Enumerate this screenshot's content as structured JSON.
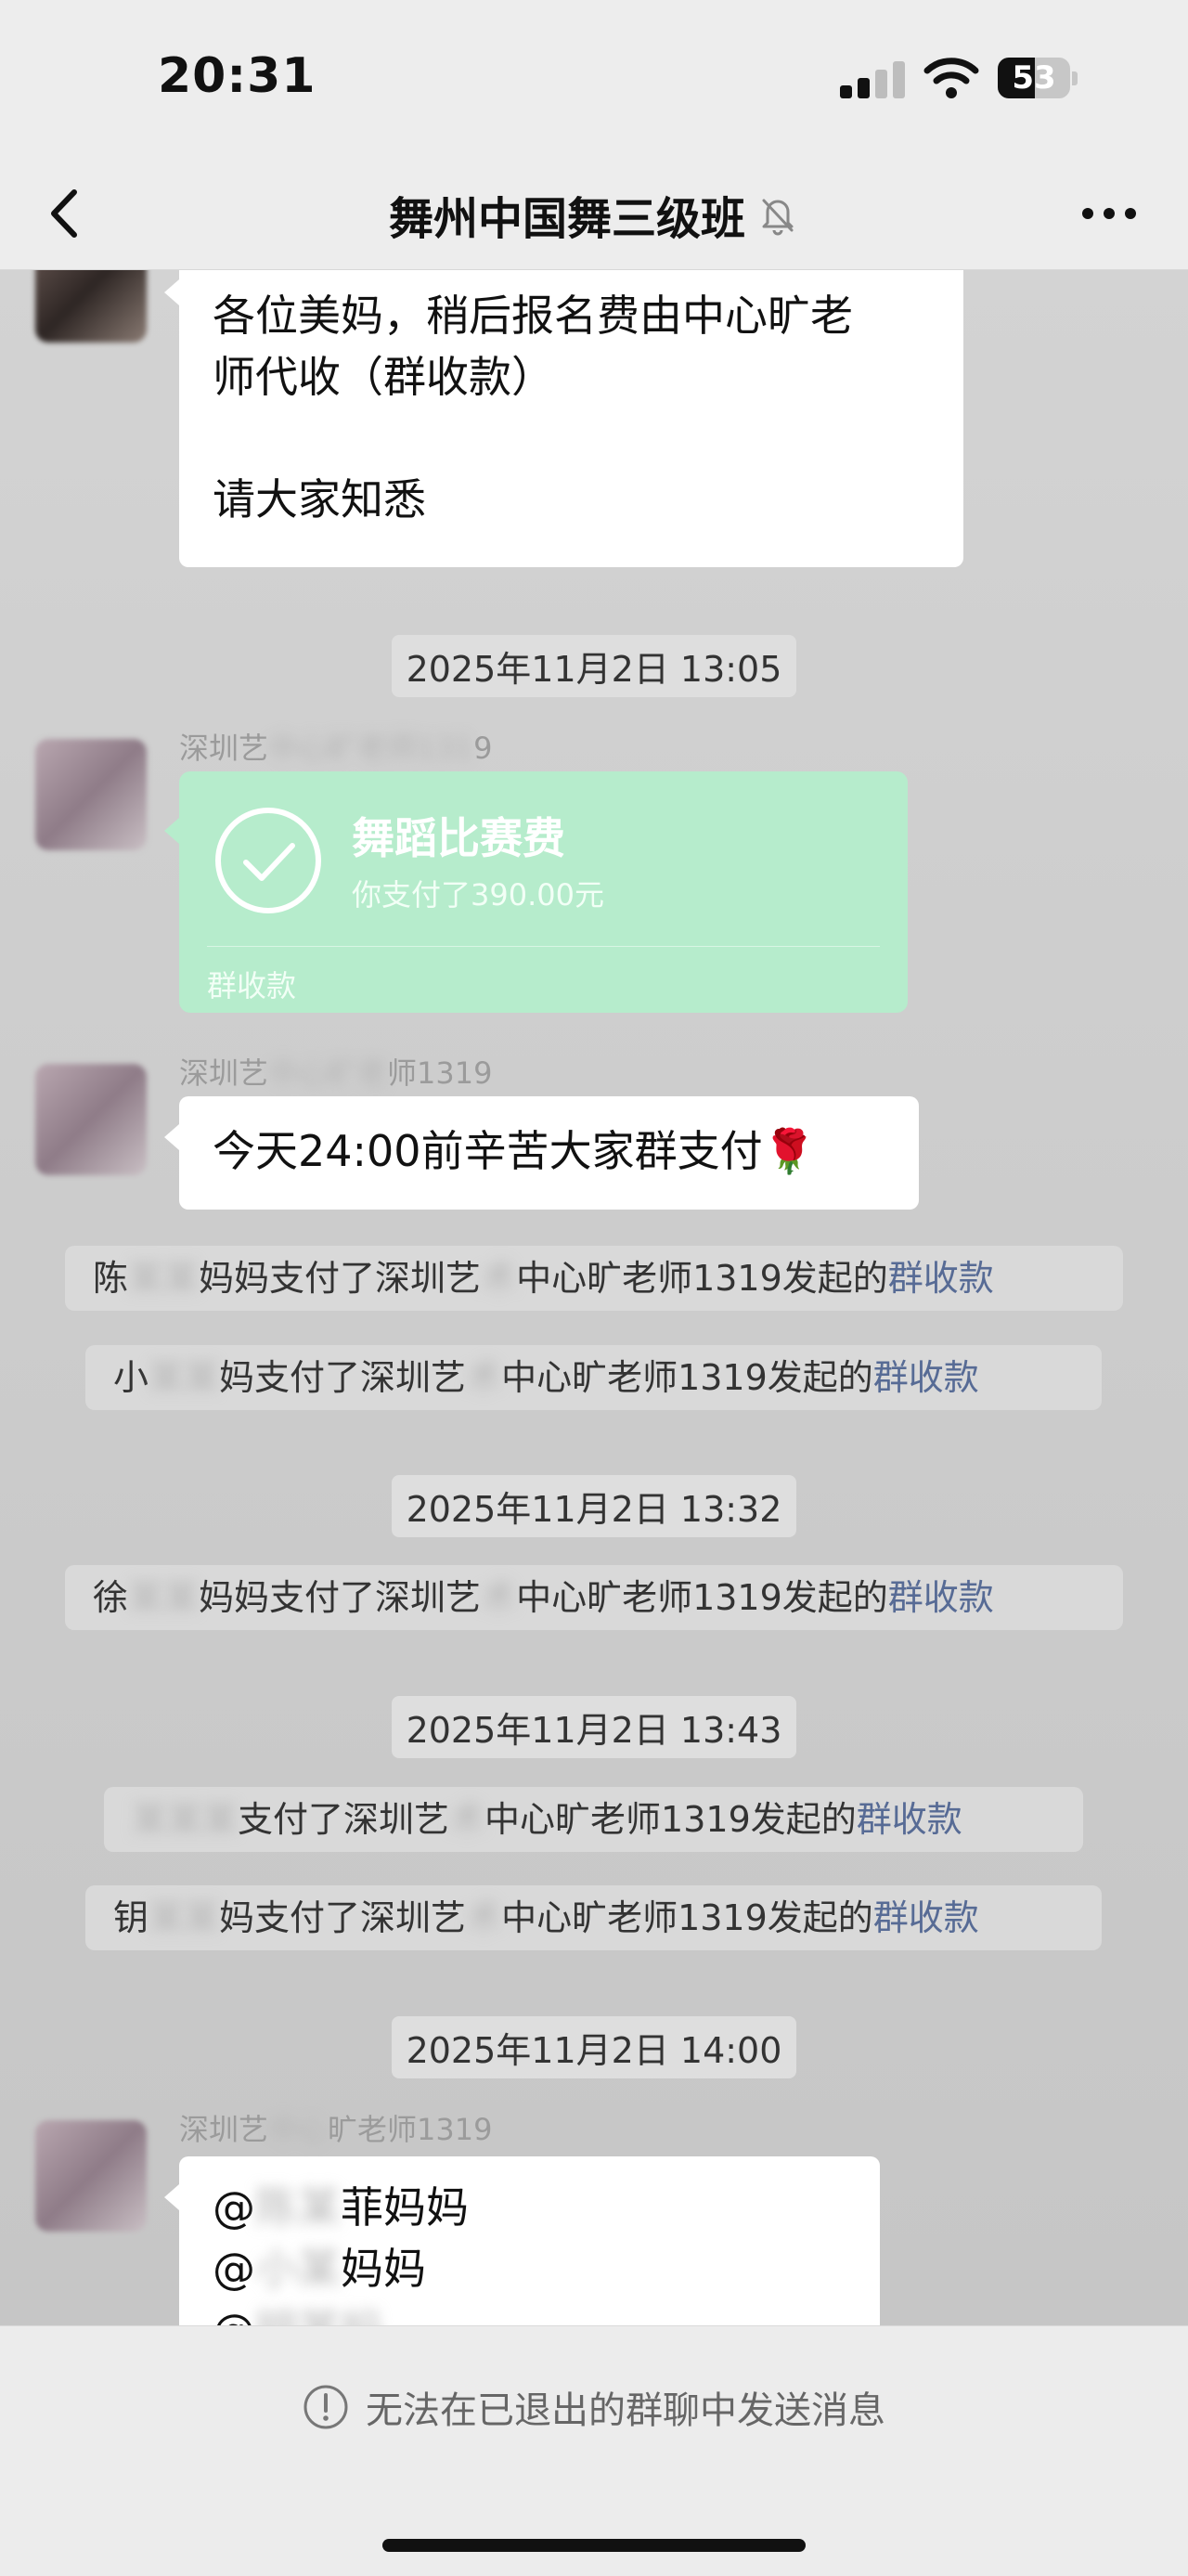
{
  "status": {
    "time": "20:31",
    "battery": "53"
  },
  "nav": {
    "back_icon": "chevron-left-icon",
    "title": "舞州中国舞三级班",
    "mute_icon": "bell-slash-icon",
    "more_icon": "ellipsis-icon"
  },
  "messages": {
    "m1": {
      "line1": "各位美妈，稍后报名费由中心旷老",
      "line2": "师代收（群收款）",
      "line3": "请大家知悉"
    },
    "t1": "2025年11月2日 13:05",
    "pay": {
      "sender_prefix": "深圳艺",
      "sender_suffix": "9",
      "title": "舞蹈比赛费",
      "subtitle": "你支付了390.00元",
      "label": "群收款"
    },
    "m2": {
      "sender_prefix": "深圳艺",
      "sender_suffix": "师1319",
      "text": "今天24:00前辛苦大家群支付",
      "emoji": "🌹"
    },
    "s1": {
      "prefix": "陈",
      "text": "妈妈支付了深圳艺",
      "mid": "中心旷老师1319发起的",
      "link": "群收款"
    },
    "s2": {
      "prefix": "小",
      "text": "妈支付了深圳艺",
      "mid": "中心旷老师1319发起的",
      "link": "群收款"
    },
    "t2": "2025年11月2日 13:32",
    "s3": {
      "prefix": "徐",
      "text": "妈妈支付了深圳艺",
      "mid": "中心旷老师1319发起的",
      "link": "群收款"
    },
    "t3": "2025年11月2日 13:43",
    "s4": {
      "prefix": "",
      "text": "支付了深圳艺",
      "mid": "中心旷老师1319发起的",
      "link": "群收款"
    },
    "s5": {
      "prefix": "钥",
      "text": "妈支付了深圳艺",
      "mid": "中心旷老师1319发起的",
      "link": "群收款"
    },
    "t4": "2025年11月2日 14:00",
    "m3": {
      "sender_prefix": "深圳艺",
      "sender_suffix": "旷老师1319",
      "line1_at": "@",
      "line1": "菲妈妈",
      "line2_at": "@",
      "line2": "妈妈",
      "line3_at": "@"
    }
  },
  "footer": {
    "icon": "info-circle-icon",
    "text": "无法在已退出的群聊中发送消息"
  }
}
